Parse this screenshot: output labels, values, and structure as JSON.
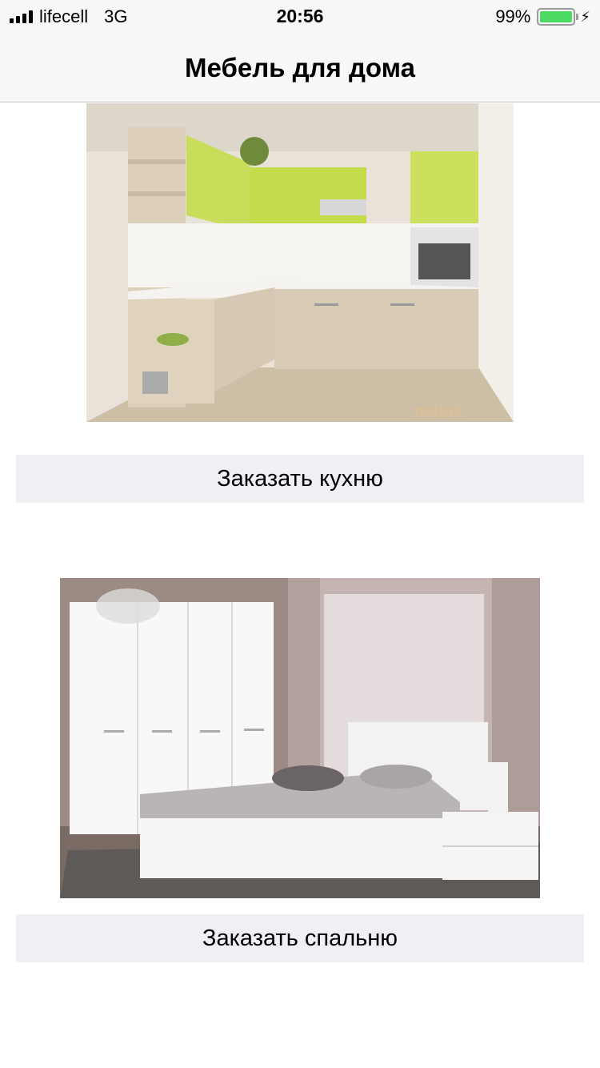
{
  "status_bar": {
    "carrier": "lifecell",
    "network": "3G",
    "time": "20:56",
    "battery": "99%",
    "battery_level": 0.99,
    "battery_color": "#4cd964",
    "icons": [
      "signal-icon",
      "battery-icon",
      "charging-bolt-icon"
    ]
  },
  "nav": {
    "title": "Мебель для дома"
  },
  "items": [
    {
      "image": "kitchen-photo",
      "button_label": "Заказать кухню"
    },
    {
      "image": "bedroom-photo",
      "button_label": "Заказать спальню"
    }
  ],
  "watermark": "mebel"
}
